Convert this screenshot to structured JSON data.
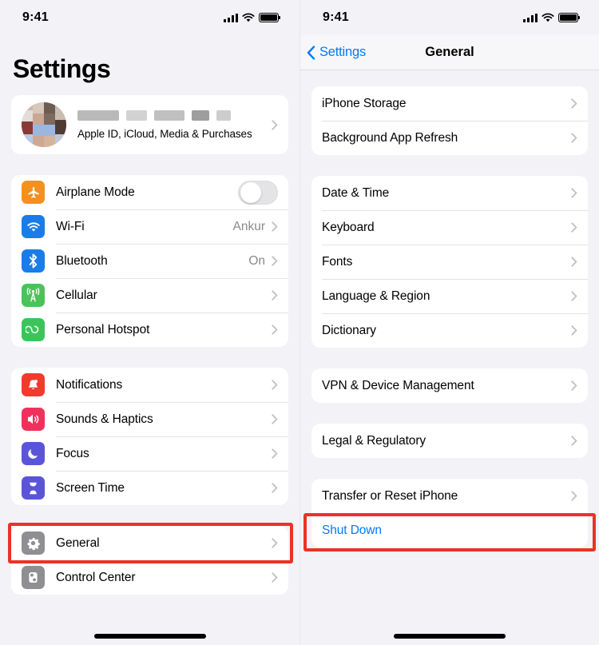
{
  "status_bar": {
    "time": "9:41",
    "signal_icon": "cellular-signal-icon",
    "wifi_icon": "wifi-icon",
    "battery_icon": "battery-full-icon"
  },
  "left_panel": {
    "title": "Settings",
    "profile": {
      "name_redacted": true,
      "subtitle": "Apple ID, iCloud, Media & Purchases",
      "avatar_icon": "profile-avatar"
    },
    "groups": [
      {
        "id": "connectivity",
        "rows": [
          {
            "label": "Airplane Mode",
            "icon": "airplane-icon",
            "icon_color": "#f5901d",
            "control": "toggle",
            "toggle_on": false
          },
          {
            "label": "Wi-Fi",
            "icon": "wifi-icon",
            "icon_color": "#1a7ce8",
            "value": "Ankur",
            "control": "chevron"
          },
          {
            "label": "Bluetooth",
            "icon": "bluetooth-icon",
            "icon_color": "#1a7ce8",
            "value": "On",
            "control": "chevron"
          },
          {
            "label": "Cellular",
            "icon": "cellular-antenna-icon",
            "icon_color": "#4cc25b",
            "value": "",
            "control": "chevron"
          },
          {
            "label": "Personal Hotspot",
            "icon": "hotspot-link-icon",
            "icon_color": "#3cc45b",
            "value": "",
            "control": "chevron"
          }
        ]
      },
      {
        "id": "alerts",
        "rows": [
          {
            "label": "Notifications",
            "icon": "bell-icon",
            "icon_color": "#f03b2d",
            "value": "",
            "control": "chevron"
          },
          {
            "label": "Sounds & Haptics",
            "icon": "speaker-icon",
            "icon_color": "#f0315c",
            "value": "",
            "control": "chevron"
          },
          {
            "label": "Focus",
            "icon": "moon-icon",
            "icon_color": "#5a55d8",
            "value": "",
            "control": "chevron"
          },
          {
            "label": "Screen Time",
            "icon": "hourglass-icon",
            "icon_color": "#5a55d8",
            "value": "",
            "control": "chevron"
          }
        ]
      },
      {
        "id": "system",
        "rows": [
          {
            "label": "General",
            "icon": "gear-icon",
            "icon_color": "#8e8e93",
            "value": "",
            "control": "chevron",
            "highlighted": true
          },
          {
            "label": "Control Center",
            "icon": "control-center-icon",
            "icon_color": "#8e8e93",
            "value": "",
            "control": "chevron"
          }
        ]
      }
    ]
  },
  "right_panel": {
    "nav": {
      "back_label": "Settings",
      "back_icon": "chevron-left-icon",
      "title": "General"
    },
    "groups": [
      {
        "id": "storage",
        "rows": [
          {
            "label": "iPhone Storage",
            "control": "chevron"
          },
          {
            "label": "Background App Refresh",
            "control": "chevron"
          }
        ]
      },
      {
        "id": "locale",
        "rows": [
          {
            "label": "Date & Time",
            "control": "chevron"
          },
          {
            "label": "Keyboard",
            "control": "chevron"
          },
          {
            "label": "Fonts",
            "control": "chevron"
          },
          {
            "label": "Language & Region",
            "control": "chevron"
          },
          {
            "label": "Dictionary",
            "control": "chevron"
          }
        ]
      },
      {
        "id": "vpn",
        "rows": [
          {
            "label": "VPN & Device Management",
            "control": "chevron"
          }
        ]
      },
      {
        "id": "legal",
        "rows": [
          {
            "label": "Legal & Regulatory",
            "control": "chevron"
          }
        ]
      },
      {
        "id": "reset",
        "rows": [
          {
            "label": "Transfer or Reset iPhone",
            "control": "chevron"
          },
          {
            "label": "Shut Down",
            "control": "none",
            "style": "blue",
            "highlighted": true
          }
        ]
      }
    ]
  },
  "annotations": {
    "highlight_color": "#ee3124",
    "targets": [
      "General",
      "Shut Down"
    ]
  },
  "colors": {
    "background": "#f2f2f7",
    "card": "#ffffff",
    "accent_blue": "#007aff",
    "separator": "#e3e3e7",
    "secondary_text": "#8a8a8e"
  }
}
